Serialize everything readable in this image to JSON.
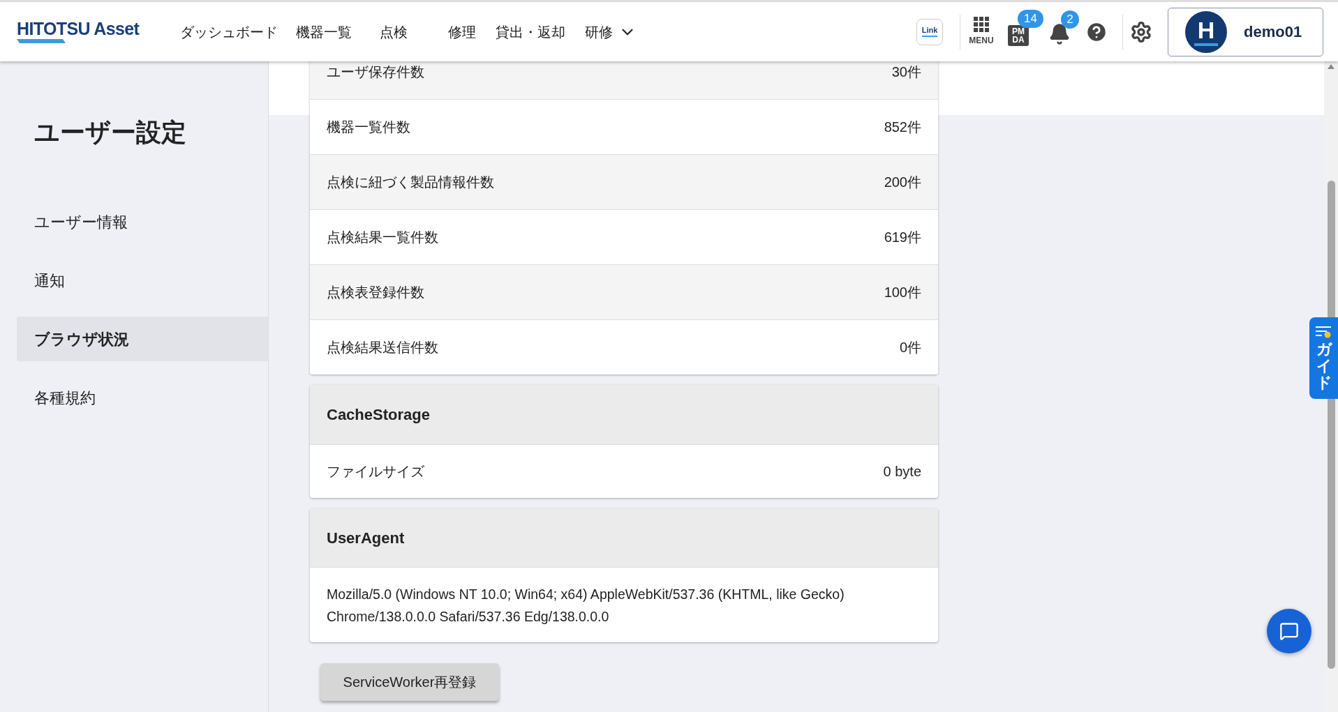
{
  "header": {
    "logo": "HITOTSU Asset",
    "nav": [
      {
        "label": "ダッシュボード",
        "dropdown": false
      },
      {
        "label": "機器一覧",
        "dropdown": false
      },
      {
        "label": "点検",
        "dropdown": false
      },
      {
        "label": "修理",
        "dropdown": false
      },
      {
        "label": "貸出・返却",
        "dropdown": false
      },
      {
        "label": "研修",
        "dropdown": true
      }
    ],
    "link_app": "Link",
    "menu_label": "MENU",
    "pmda": {
      "top": "PM",
      "bottom": "DA",
      "badge": "14"
    },
    "notifications_badge": "2",
    "avatar_letter": "H",
    "user": "demo01"
  },
  "sidebar": {
    "title": "ユーザー設定",
    "items": [
      {
        "label": "ユーザー情報",
        "selected": false
      },
      {
        "label": "通知",
        "selected": false
      },
      {
        "label": "ブラウザ状況",
        "selected": true
      },
      {
        "label": "各種規約",
        "selected": false
      }
    ]
  },
  "counts": [
    {
      "label": "ユーザ保存件数",
      "value": "30件"
    },
    {
      "label": "機器一覧件数",
      "value": "852件"
    },
    {
      "label": "点検に紐づく製品情報件数",
      "value": "200件"
    },
    {
      "label": "点検結果一覧件数",
      "value": "619件"
    },
    {
      "label": "点検表登録件数",
      "value": "100件"
    },
    {
      "label": "点検結果送信件数",
      "value": "0件"
    }
  ],
  "cache_storage": {
    "title": "CacheStorage",
    "rows": [
      {
        "label": "ファイルサイズ",
        "value": "0 byte"
      }
    ]
  },
  "user_agent": {
    "title": "UserAgent",
    "text": "Mozilla/5.0 (Windows NT 10.0; Win64; x64) AppleWebKit/537.36 (KHTML, like Gecko) Chrome/138.0.0.0 Safari/537.36 Edg/138.0.0.0"
  },
  "reregister_button": "ServiceWorker再登録",
  "guide_tab": "ガイド"
}
